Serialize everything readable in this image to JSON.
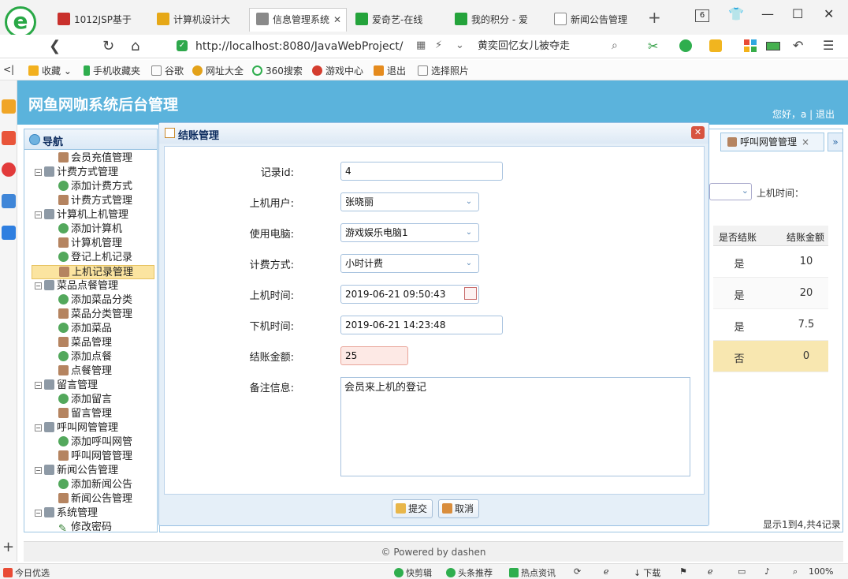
{
  "browser": {
    "tabs": [
      {
        "label": "1012JSP基于",
        "color": "#c9302c"
      },
      {
        "label": "计算机设计大",
        "color": "#e6a817"
      },
      {
        "label": "信息管理系统",
        "color": "#8a8a8a",
        "active": true
      },
      {
        "label": "爱奇艺-在线",
        "color": "#24a33b"
      },
      {
        "label": "我的积分 - 爱",
        "color": "#24a33b"
      },
      {
        "label": "新闻公告管理",
        "color": "#888888"
      }
    ],
    "tab_count": "6",
    "url": "http://localhost:8080/JavaWebProject/",
    "search_text": "黄奕回忆女儿被夺走",
    "bookmarks": [
      "收藏",
      "手机收藏夹",
      "谷歌",
      "网址大全",
      "360搜索",
      "游戏中心",
      "退出",
      "选择照片"
    ]
  },
  "app": {
    "title": "网鱼网咖系统后台管理",
    "greeting": "您好，a | 退出",
    "nav_title": "导航",
    "tree": [
      {
        "label": "会员充值管理",
        "level": 2,
        "icon": "user-icon"
      },
      {
        "label": "计费方式管理",
        "level": 1,
        "icon": "folder-icon"
      },
      {
        "label": "添加计费方式",
        "level": 2,
        "icon": "add-icon"
      },
      {
        "label": "计费方式管理",
        "level": 2,
        "icon": "user-icon"
      },
      {
        "label": "计算机上机管理",
        "level": 1,
        "icon": "folder-icon"
      },
      {
        "label": "添加计算机",
        "level": 2,
        "icon": "add-icon"
      },
      {
        "label": "计算机管理",
        "level": 2,
        "icon": "user-icon"
      },
      {
        "label": "登记上机记录",
        "level": 2,
        "icon": "add-icon"
      },
      {
        "label": "上机记录管理",
        "level": 2,
        "icon": "user-icon",
        "selected": true
      },
      {
        "label": "菜品点餐管理",
        "level": 1,
        "icon": "folder-icon"
      },
      {
        "label": "添加菜品分类",
        "level": 2,
        "icon": "add-icon"
      },
      {
        "label": "菜品分类管理",
        "level": 2,
        "icon": "user-icon"
      },
      {
        "label": "添加菜品",
        "level": 2,
        "icon": "add-icon"
      },
      {
        "label": "菜品管理",
        "level": 2,
        "icon": "user-icon"
      },
      {
        "label": "添加点餐",
        "level": 2,
        "icon": "add-icon"
      },
      {
        "label": "点餐管理",
        "level": 2,
        "icon": "user-icon"
      },
      {
        "label": "留言管理",
        "level": 1,
        "icon": "folder-icon"
      },
      {
        "label": "添加留言",
        "level": 2,
        "icon": "add-icon"
      },
      {
        "label": "留言管理",
        "level": 2,
        "icon": "user-icon"
      },
      {
        "label": "呼叫网管管理",
        "level": 1,
        "icon": "folder-icon"
      },
      {
        "label": "添加呼叫网管",
        "level": 2,
        "icon": "add-icon"
      },
      {
        "label": "呼叫网管管理",
        "level": 2,
        "icon": "user-icon"
      },
      {
        "label": "新闻公告管理",
        "level": 1,
        "icon": "folder-icon"
      },
      {
        "label": "添加新闻公告",
        "level": 2,
        "icon": "add-icon"
      },
      {
        "label": "新闻公告管理",
        "level": 2,
        "icon": "user-icon"
      },
      {
        "label": "系统管理",
        "level": 1,
        "icon": "folder-icon"
      },
      {
        "label": "修改密码",
        "level": 2,
        "icon": "pencil-icon"
      }
    ],
    "open_tab": "呼叫网管管理",
    "filter_label": "上机时间：",
    "grid": {
      "columns": [
        "是否结账",
        "结账金额"
      ],
      "rows": [
        [
          "是",
          "10"
        ],
        [
          "是",
          "20"
        ],
        [
          "是",
          "7.5"
        ],
        [
          "否",
          "0"
        ]
      ]
    },
    "pager": "显示1到4,共4记录",
    "footer": "© Powered by dashen"
  },
  "dialog": {
    "title": "结账管理",
    "labels": {
      "record_id": "记录id:",
      "user": "上机用户:",
      "computer": "使用电脑:",
      "billing": "计费方式:",
      "start": "上机时间:",
      "end": "下机时间:",
      "amount": "结账金额:",
      "remark": "备注信息:"
    },
    "values": {
      "record_id": "4",
      "user": "张晓丽",
      "computer": "游戏娱乐电脑1",
      "billing": "小时计费",
      "start": "2019-06-21 09:50:43",
      "end": "2019-06-21 14:23:48",
      "amount": "25",
      "remark": "会员来上机的登记"
    },
    "submit": "提交",
    "cancel": "取消"
  },
  "statusbar": {
    "left": "今日优选",
    "items": [
      "快剪辑",
      "头条推荐",
      "热点资讯",
      "下载"
    ],
    "zoom": "100%"
  }
}
